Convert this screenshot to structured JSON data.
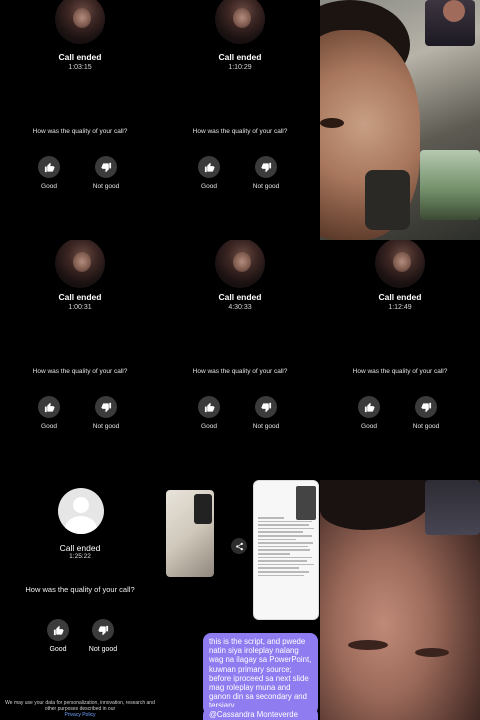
{
  "calls": [
    {
      "title": "Call ended",
      "duration": "1:03:15",
      "question": "How was the quality of your call?",
      "good": "Good",
      "not_good": "Not good"
    },
    {
      "title": "Call ended",
      "duration": "1:10:29",
      "question": "How was the quality of your call?",
      "good": "Good",
      "not_good": "Not good"
    },
    {
      "title": "Call ended",
      "duration": "1:00:31",
      "question": "How was the quality of your call?",
      "good": "Good",
      "not_good": "Not good"
    },
    {
      "title": "Call ended",
      "duration": "4:30:33",
      "question": "How was the quality of your call?",
      "good": "Good",
      "not_good": "Not good"
    },
    {
      "title": "Call ended",
      "duration": "1:12:49",
      "question": "How was the quality of your call?",
      "good": "Good",
      "not_good": "Not good"
    },
    {
      "title": "Call ended",
      "duration": "1:25:22",
      "question": "How was the quality of your call?",
      "good": "Good",
      "not_good": "Not good"
    }
  ],
  "disclaimer": {
    "text": "We may use your data for personalization, innovation, research and other purposes described in our",
    "link": "Privacy Policy"
  },
  "chat": {
    "message": "this is the script, and pwede natin siya iroleplay nalang wag na ilagay sa PowerPoint, kuwnan primary source; before iproceed sa next slide mag roleplay muna and ganon din sa secondary and tersiary",
    "mention": "@Cassandra Monteverde"
  },
  "icons": {
    "thumbs_up": "thumbs-up-icon",
    "thumbs_down": "thumbs-down-icon",
    "share": "share-icon"
  }
}
